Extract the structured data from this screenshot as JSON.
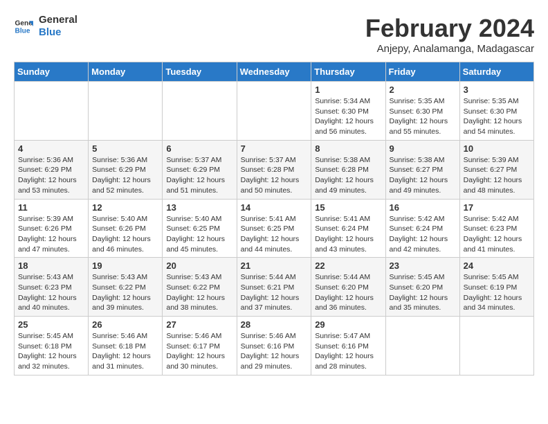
{
  "logo": {
    "line1": "General",
    "line2": "Blue"
  },
  "title": "February 2024",
  "location": "Anjepy, Analamanga, Madagascar",
  "days_of_week": [
    "Sunday",
    "Monday",
    "Tuesday",
    "Wednesday",
    "Thursday",
    "Friday",
    "Saturday"
  ],
  "weeks": [
    [
      {
        "day": "",
        "info": ""
      },
      {
        "day": "",
        "info": ""
      },
      {
        "day": "",
        "info": ""
      },
      {
        "day": "",
        "info": ""
      },
      {
        "day": "1",
        "info": "Sunrise: 5:34 AM\nSunset: 6:30 PM\nDaylight: 12 hours\nand 56 minutes."
      },
      {
        "day": "2",
        "info": "Sunrise: 5:35 AM\nSunset: 6:30 PM\nDaylight: 12 hours\nand 55 minutes."
      },
      {
        "day": "3",
        "info": "Sunrise: 5:35 AM\nSunset: 6:30 PM\nDaylight: 12 hours\nand 54 minutes."
      }
    ],
    [
      {
        "day": "4",
        "info": "Sunrise: 5:36 AM\nSunset: 6:29 PM\nDaylight: 12 hours\nand 53 minutes."
      },
      {
        "day": "5",
        "info": "Sunrise: 5:36 AM\nSunset: 6:29 PM\nDaylight: 12 hours\nand 52 minutes."
      },
      {
        "day": "6",
        "info": "Sunrise: 5:37 AM\nSunset: 6:29 PM\nDaylight: 12 hours\nand 51 minutes."
      },
      {
        "day": "7",
        "info": "Sunrise: 5:37 AM\nSunset: 6:28 PM\nDaylight: 12 hours\nand 50 minutes."
      },
      {
        "day": "8",
        "info": "Sunrise: 5:38 AM\nSunset: 6:28 PM\nDaylight: 12 hours\nand 49 minutes."
      },
      {
        "day": "9",
        "info": "Sunrise: 5:38 AM\nSunset: 6:27 PM\nDaylight: 12 hours\nand 49 minutes."
      },
      {
        "day": "10",
        "info": "Sunrise: 5:39 AM\nSunset: 6:27 PM\nDaylight: 12 hours\nand 48 minutes."
      }
    ],
    [
      {
        "day": "11",
        "info": "Sunrise: 5:39 AM\nSunset: 6:26 PM\nDaylight: 12 hours\nand 47 minutes."
      },
      {
        "day": "12",
        "info": "Sunrise: 5:40 AM\nSunset: 6:26 PM\nDaylight: 12 hours\nand 46 minutes."
      },
      {
        "day": "13",
        "info": "Sunrise: 5:40 AM\nSunset: 6:25 PM\nDaylight: 12 hours\nand 45 minutes."
      },
      {
        "day": "14",
        "info": "Sunrise: 5:41 AM\nSunset: 6:25 PM\nDaylight: 12 hours\nand 44 minutes."
      },
      {
        "day": "15",
        "info": "Sunrise: 5:41 AM\nSunset: 6:24 PM\nDaylight: 12 hours\nand 43 minutes."
      },
      {
        "day": "16",
        "info": "Sunrise: 5:42 AM\nSunset: 6:24 PM\nDaylight: 12 hours\nand 42 minutes."
      },
      {
        "day": "17",
        "info": "Sunrise: 5:42 AM\nSunset: 6:23 PM\nDaylight: 12 hours\nand 41 minutes."
      }
    ],
    [
      {
        "day": "18",
        "info": "Sunrise: 5:43 AM\nSunset: 6:23 PM\nDaylight: 12 hours\nand 40 minutes."
      },
      {
        "day": "19",
        "info": "Sunrise: 5:43 AM\nSunset: 6:22 PM\nDaylight: 12 hours\nand 39 minutes."
      },
      {
        "day": "20",
        "info": "Sunrise: 5:43 AM\nSunset: 6:22 PM\nDaylight: 12 hours\nand 38 minutes."
      },
      {
        "day": "21",
        "info": "Sunrise: 5:44 AM\nSunset: 6:21 PM\nDaylight: 12 hours\nand 37 minutes."
      },
      {
        "day": "22",
        "info": "Sunrise: 5:44 AM\nSunset: 6:20 PM\nDaylight: 12 hours\nand 36 minutes."
      },
      {
        "day": "23",
        "info": "Sunrise: 5:45 AM\nSunset: 6:20 PM\nDaylight: 12 hours\nand 35 minutes."
      },
      {
        "day": "24",
        "info": "Sunrise: 5:45 AM\nSunset: 6:19 PM\nDaylight: 12 hours\nand 34 minutes."
      }
    ],
    [
      {
        "day": "25",
        "info": "Sunrise: 5:45 AM\nSunset: 6:18 PM\nDaylight: 12 hours\nand 32 minutes."
      },
      {
        "day": "26",
        "info": "Sunrise: 5:46 AM\nSunset: 6:18 PM\nDaylight: 12 hours\nand 31 minutes."
      },
      {
        "day": "27",
        "info": "Sunrise: 5:46 AM\nSunset: 6:17 PM\nDaylight: 12 hours\nand 30 minutes."
      },
      {
        "day": "28",
        "info": "Sunrise: 5:46 AM\nSunset: 6:16 PM\nDaylight: 12 hours\nand 29 minutes."
      },
      {
        "day": "29",
        "info": "Sunrise: 5:47 AM\nSunset: 6:16 PM\nDaylight: 12 hours\nand 28 minutes."
      },
      {
        "day": "",
        "info": ""
      },
      {
        "day": "",
        "info": ""
      }
    ]
  ]
}
